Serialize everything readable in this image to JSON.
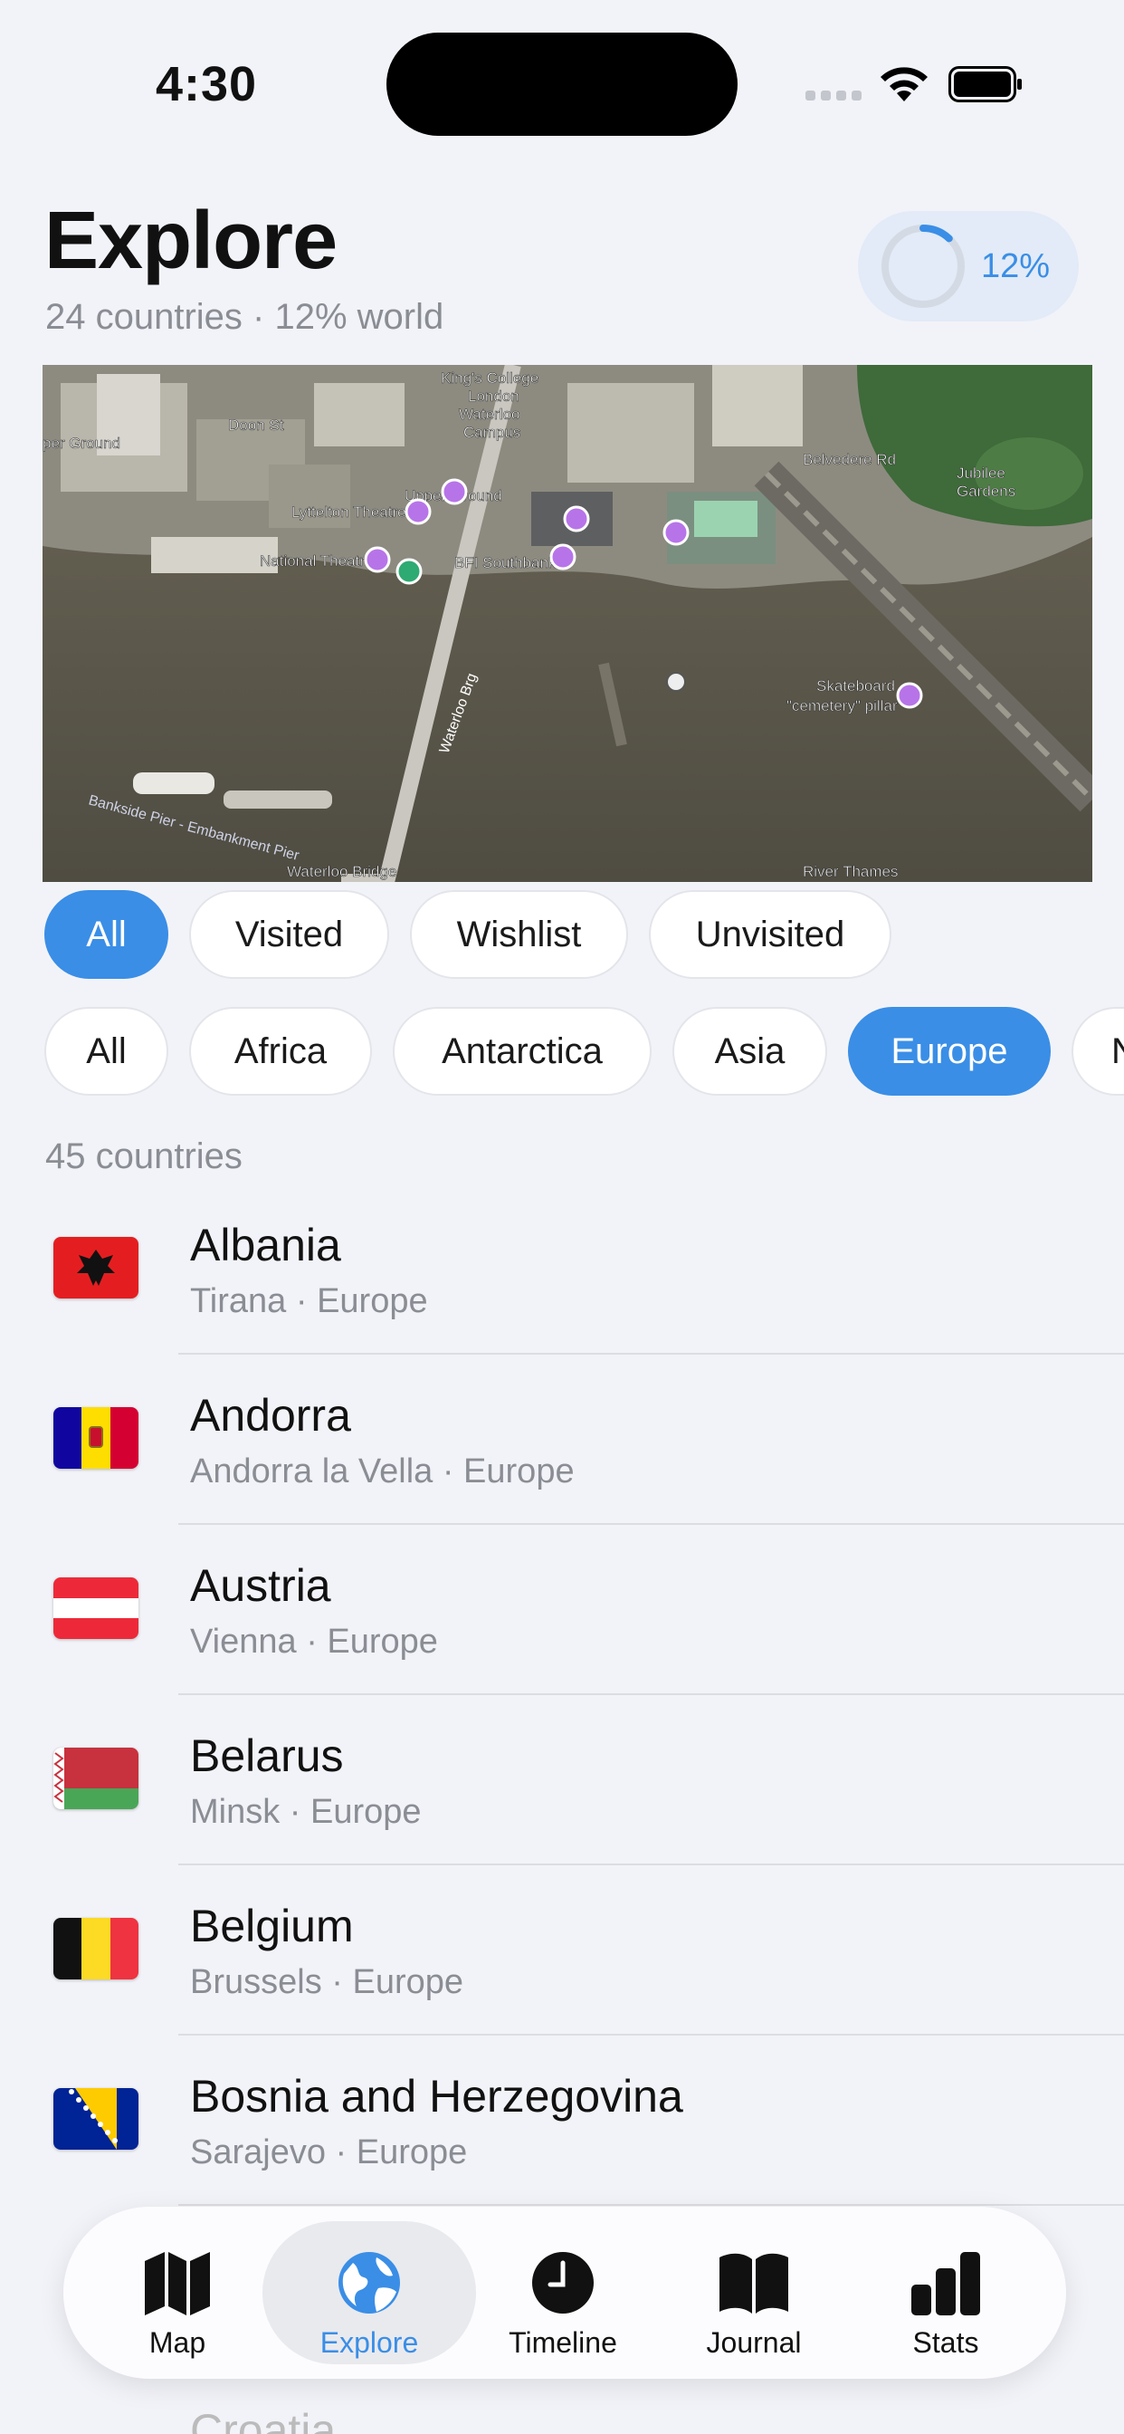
{
  "status": {
    "time": "4:30"
  },
  "header": {
    "title": "Explore",
    "subtitle": "24 countries · 12% world",
    "progress_label": "12%",
    "progress_fraction": 0.12
  },
  "map": {
    "labels": [
      "King's College London Waterloo Campus",
      "Lyttelton Theatre",
      "National Theatre",
      "BFI Southbank",
      "Upper Ground",
      "Doon St",
      "Belvedere Rd",
      "Jubilee Gardens",
      "Waterloo Brg",
      "Skateboard \"cemetery\" pillar",
      "Bankside Pier - Embankment Pier",
      "Waterloo Bridge",
      "River Thames",
      "Duchy St",
      "Upper Ground"
    ]
  },
  "status_filters": [
    {
      "label": "All",
      "active": true
    },
    {
      "label": "Visited",
      "active": false
    },
    {
      "label": "Wishlist",
      "active": false
    },
    {
      "label": "Unvisited",
      "active": false
    }
  ],
  "region_filters": [
    {
      "label": "All",
      "active": false
    },
    {
      "label": "Africa",
      "active": false
    },
    {
      "label": "Antarctica",
      "active": false
    },
    {
      "label": "Asia",
      "active": false
    },
    {
      "label": "Europe",
      "active": true
    },
    {
      "label": "N",
      "active": false
    }
  ],
  "list": {
    "count_label": "45 countries",
    "countries": [
      {
        "name": "Albania",
        "detail": "Tirana · Europe",
        "flag": "albania-flag-icon"
      },
      {
        "name": "Andorra",
        "detail": "Andorra la Vella · Europe",
        "flag": "andorra-flag-icon"
      },
      {
        "name": "Austria",
        "detail": "Vienna · Europe",
        "flag": "austria-flag-icon"
      },
      {
        "name": "Belarus",
        "detail": "Minsk · Europe",
        "flag": "belarus-flag-icon"
      },
      {
        "name": "Belgium",
        "detail": "Brussels · Europe",
        "flag": "belgium-flag-icon"
      },
      {
        "name": "Bosnia and Herzegovina",
        "detail": "Sarajevo · Europe",
        "flag": "bosnia-flag-icon"
      }
    ],
    "partial_next": "Croatia"
  },
  "tabs": [
    {
      "label": "Map",
      "icon": "map-icon",
      "active": false
    },
    {
      "label": "Explore",
      "icon": "globe-icon",
      "active": true
    },
    {
      "label": "Timeline",
      "icon": "clock-icon",
      "active": false
    },
    {
      "label": "Journal",
      "icon": "book-icon",
      "active": false
    },
    {
      "label": "Stats",
      "icon": "bar-chart-icon",
      "active": false
    }
  ],
  "colors": {
    "accent": "#3a8ee6",
    "background": "#f2f3f8",
    "muted": "#8a8d94"
  }
}
